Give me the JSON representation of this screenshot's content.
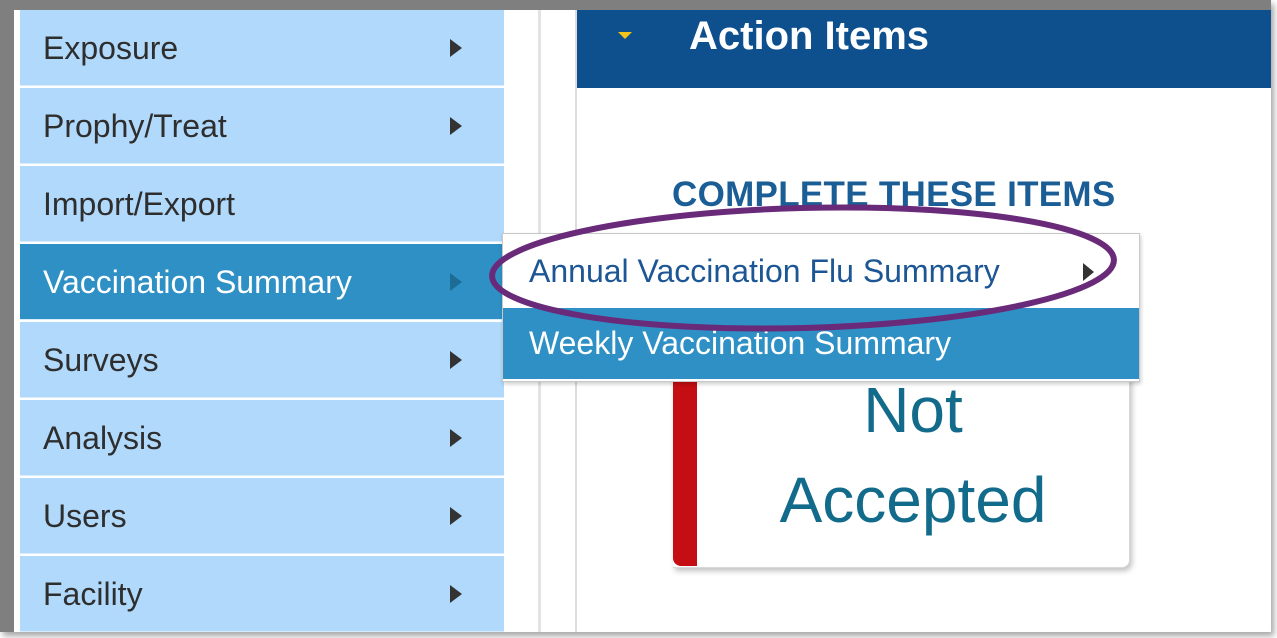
{
  "sidebar": {
    "items": [
      {
        "label": "Exposure",
        "active": false
      },
      {
        "label": "Prophy/Treat",
        "active": false
      },
      {
        "label": "Import/Export",
        "active": false
      },
      {
        "label": "Vaccination Summary",
        "active": true
      },
      {
        "label": "Surveys",
        "active": false
      },
      {
        "label": "Analysis",
        "active": false
      },
      {
        "label": "Users",
        "active": false
      },
      {
        "label": "Facility",
        "active": false
      }
    ]
  },
  "panel": {
    "title": "Action Items",
    "heading": "COMPLETE THESE ITEMS",
    "status": {
      "line1": "Not",
      "line2": "Accepted",
      "color": "#c40e13"
    }
  },
  "submenu": {
    "items": [
      {
        "label": "Annual Vaccination Flu Summary"
      },
      {
        "label": "Weekly Vaccination Summary"
      }
    ]
  },
  "colors": {
    "sidebar_bg": "#b1d9fb",
    "active_bg": "#2e90c5",
    "header_bg": "#0e4f8e",
    "highlight_ellipse": "#6a2a7a"
  },
  "icons": {
    "nav_arrow": "chevron-right-icon",
    "panel_caret": "caret-down-icon",
    "submenu_arrow": "chevron-right-icon"
  }
}
